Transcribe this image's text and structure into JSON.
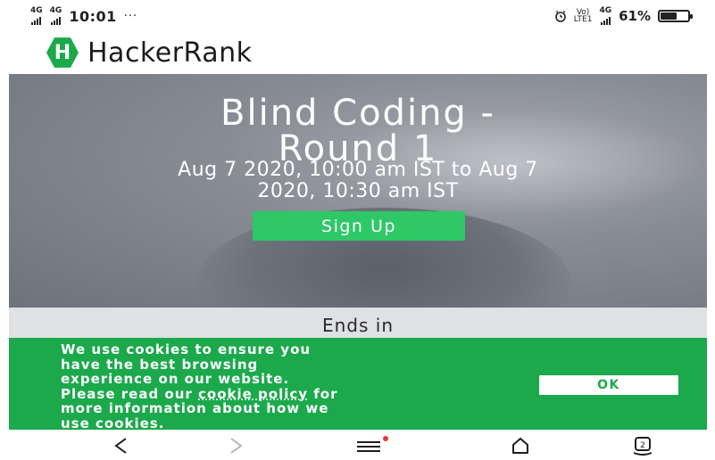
{
  "status_bar": {
    "network_1": "4G",
    "network_2": "4G",
    "time": "10:01",
    "more": "···",
    "volte_top": "Vo)",
    "volte_bottom": "LTE1",
    "net_right": "4G",
    "battery": "61%",
    "battery_level": 0.61
  },
  "header": {
    "logo_letter": "H",
    "brand": "HackerRank"
  },
  "hero": {
    "title_line1": "Blind Coding -",
    "title_line2": "Round 1",
    "dates_line1": "Aug 7 2020, 10:00 am IST to Aug 7",
    "dates_line2": "2020, 10:30 am IST",
    "signup_label": "Sign Up"
  },
  "countdown": {
    "label": "Ends in"
  },
  "cookie_banner": {
    "line1": "We use cookies to ensure you",
    "line2": "have the best browsing",
    "line3": "experience on our website.",
    "line4_pre": "Please read our ",
    "line4_link": "cookie policy",
    "line4_post": " for",
    "line5": "more information about how we",
    "line6": "use cookies.",
    "ok_label": "OK"
  },
  "nav_bar": {
    "tabs_count": "2",
    "colors": {
      "notification_dot": "#e53935"
    }
  },
  "colors": {
    "brand_green": "#1ba94c",
    "button_green": "#2ec866"
  }
}
